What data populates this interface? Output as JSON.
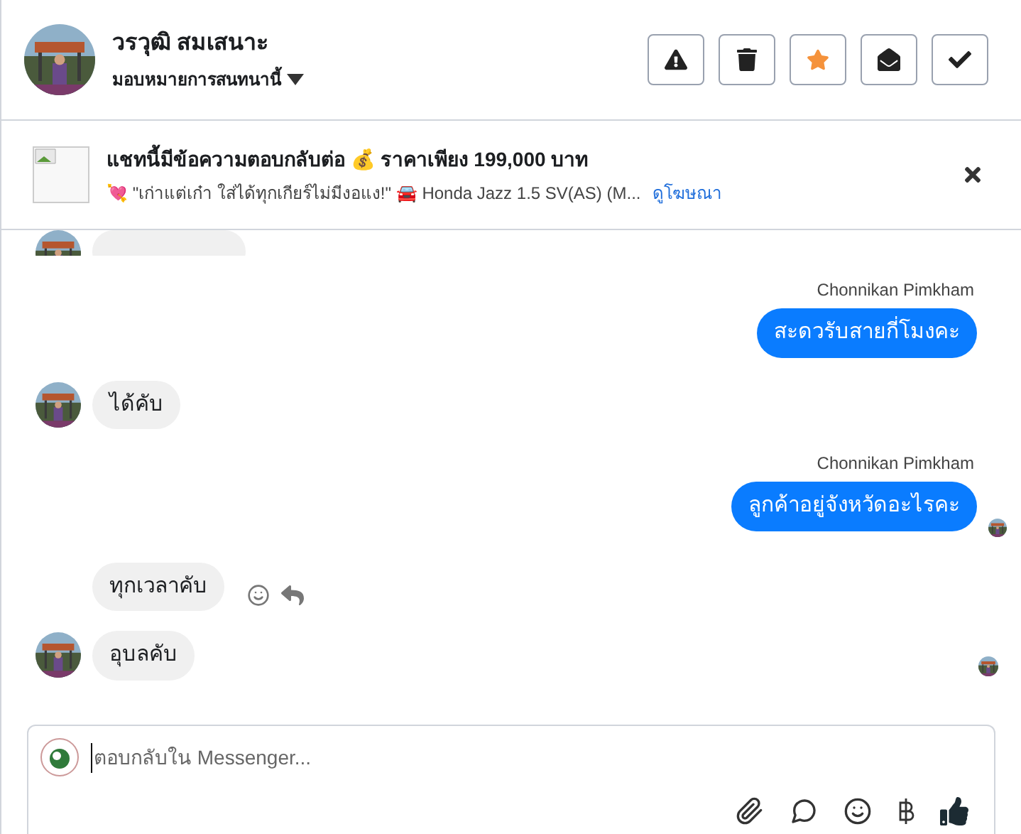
{
  "header": {
    "name": "วรวุฒิ สมเสนาะ",
    "assign": "มอบหมายการสนทนานี้",
    "actions": [
      {
        "kind": "report",
        "active": false
      },
      {
        "kind": "delete",
        "active": false
      },
      {
        "kind": "star",
        "active": true
      },
      {
        "kind": "unread",
        "active": false
      },
      {
        "kind": "done",
        "active": false
      }
    ]
  },
  "banner": {
    "title": "แชทนี้มีข้อความตอบกลับต่อ 💰 ราคาเพียง 199,000 บาท",
    "subtitle": "💘 \"เก่าแต่เก๋า ใส่ได้ทุกเกียร์ไม่มีงอแง!\" 🚘 Honda Jazz 1.5 SV(AS) (M...",
    "link": "ดูโฆษณา"
  },
  "messages": [
    {
      "kind": "incoming_cut",
      "avatar": true
    },
    {
      "kind": "outgoing",
      "sender": "Chonnikan Pimkham",
      "text": "สะดวรับสายกี่โมงคะ",
      "seen": false
    },
    {
      "kind": "incoming",
      "text": "ได้คับ",
      "avatar": true,
      "actions": false
    },
    {
      "kind": "outgoing",
      "sender": "Chonnikan Pimkham",
      "text": "ลูกค้าอยู่จังหวัดอะไรคะ",
      "seen": true
    },
    {
      "kind": "incoming",
      "text": "ทุกเวลาคับ",
      "avatar": false,
      "actions": true
    },
    {
      "kind": "incoming",
      "text": "อุบลคับ",
      "avatar": true,
      "actions": false,
      "seen": true
    }
  ],
  "composer": {
    "placeholder": "ตอบกลับใน Messenger..."
  }
}
